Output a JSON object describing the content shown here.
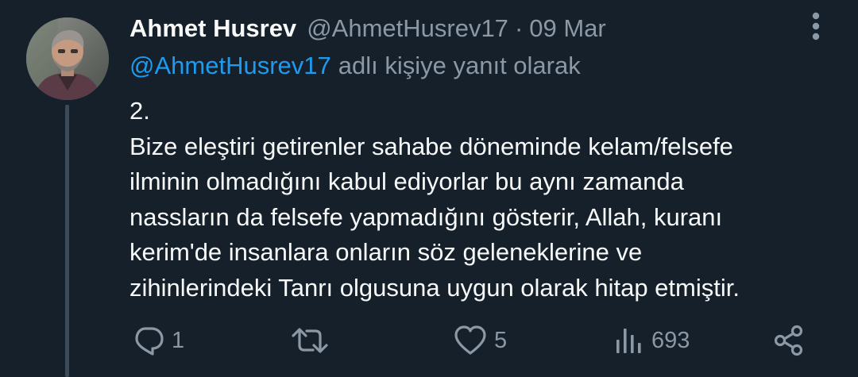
{
  "tweet": {
    "author_name": "Ahmet Husrev",
    "author_handle": "@AhmetHusrev17",
    "separator": "·",
    "date": "09 Mar",
    "reply_to_handle": "@AhmetHusrev17",
    "reply_suffix": "adlı kişiye yanıt olarak",
    "body_lines": [
      "2.",
      "Bize eleştiri getirenler sahabe döneminde kelam/felsefe",
      "ilminin olmadığını kabul ediyorlar bu aynı zamanda",
      "nassların da felsefe yapmadığını gösterir, Allah, kuranı",
      "kerim'de insanlara onların söz geleneklerine ve",
      "zihinlerindeki Tanrı olgusuna uygun olarak hitap etmiştir."
    ]
  },
  "actions": {
    "reply_count": "1",
    "retweet_count": "",
    "like_count": "5",
    "views_count": "693"
  },
  "icons": {
    "more": "vertical-dots-icon",
    "reply": "speech-bubble-icon",
    "retweet": "retweet-arrows-icon",
    "like": "heart-icon",
    "views": "bar-chart-icon",
    "share": "share-nodes-icon"
  },
  "colors": {
    "background": "#15202b",
    "text": "#f7f9f9",
    "secondary": "#8b98a5",
    "accent": "#1d9bf0",
    "thread_line": "#3d4a57"
  }
}
